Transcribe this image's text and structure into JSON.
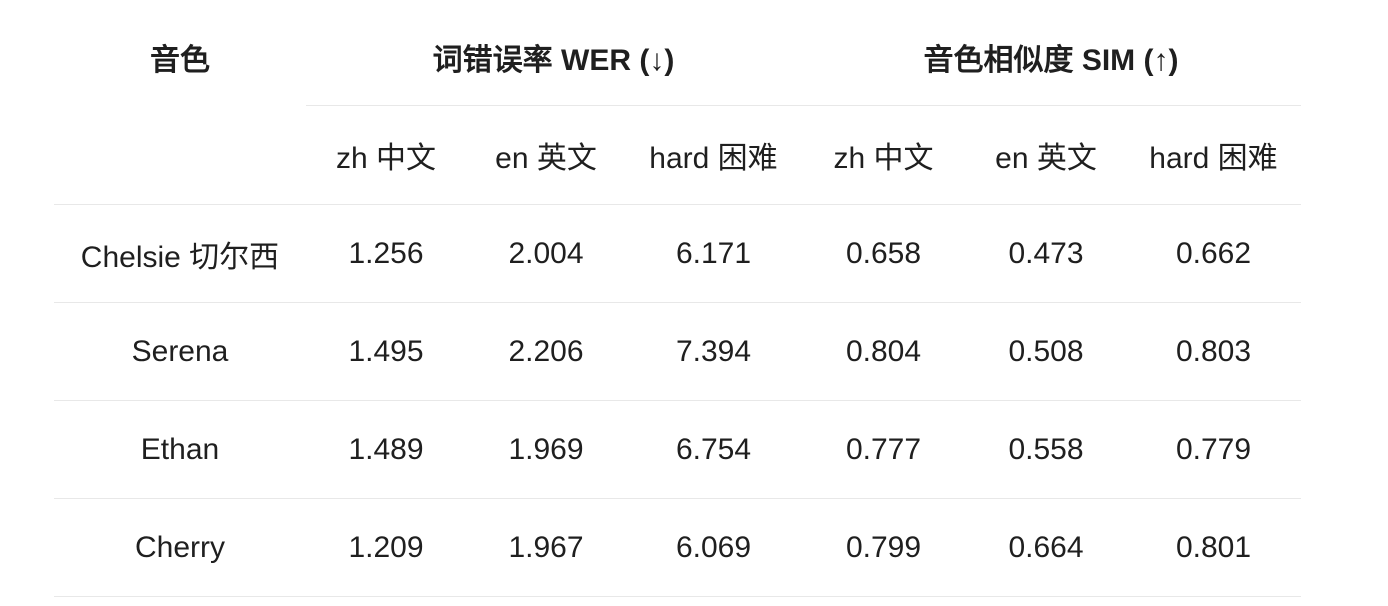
{
  "table": {
    "voice_header": "音色",
    "wer_header": "词错误率 WER (↓)",
    "sim_header": "音色相似度 SIM (↑)",
    "sub_headers": [
      "zh  中文",
      "en  英文",
      "hard  困难",
      "zh  中文",
      "en  英文",
      "hard  困难"
    ],
    "rows": [
      {
        "voice": "Chelsie  切尔西",
        "values": [
          "1.256",
          "2.004",
          "6.171",
          "0.658",
          "0.473",
          "0.662"
        ]
      },
      {
        "voice": "Serena",
        "values": [
          "1.495",
          "2.206",
          "7.394",
          "0.804",
          "0.508",
          "0.803"
        ]
      },
      {
        "voice": "Ethan",
        "values": [
          "1.489",
          "1.969",
          "6.754",
          "0.777",
          "0.558",
          "0.779"
        ]
      },
      {
        "voice": "Cherry",
        "values": [
          "1.209",
          "1.967",
          "6.069",
          "0.799",
          "0.664",
          "0.801"
        ]
      }
    ]
  }
}
